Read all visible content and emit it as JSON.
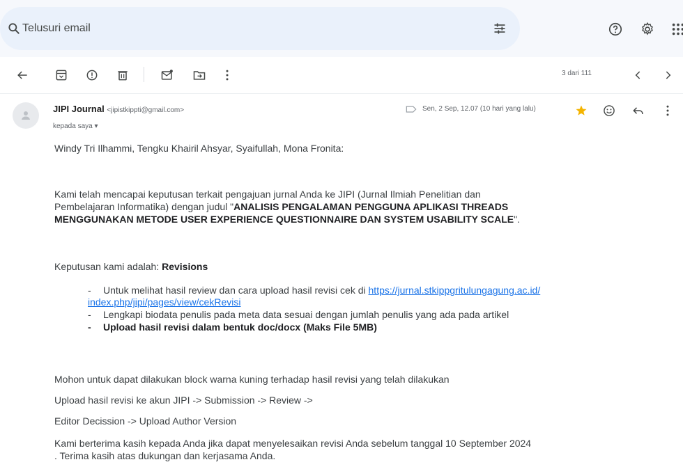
{
  "search": {
    "placeholder": "Telusuri email"
  },
  "toolbar": {
    "pager_text": "3 dari 111"
  },
  "email": {
    "sender_name": "JIPI Journal",
    "sender_email": "<jipistkippti@gmail.com>",
    "recipient": "kepada saya ▾",
    "date": "Sen, 2 Sep, 12.07 (10 hari yang lalu)",
    "greeting": "Windy Tri Ilhammi, Tengku Khairil Ahsyar, Syaifullah, Mona Fronita:",
    "para1_line1": "Kami telah mencapai keputusan terkait pengajuan jurnal Anda ke JIPI (Jurnal Ilmiah Penelitian dan",
    "para1_line2_prefix": "Pembelajaran Informatika) dengan judul \"",
    "title_line1": "ANALISIS PENGALAMAN PENGGUNA APLIKASI THREADS",
    "title_line2": "MENGGUNAKAN METODE USER EXPERIENCE QUESTIONNAIRE DAN SYSTEM USABILITY SCALE",
    "title_suffix": "\".",
    "decision_prefix": "Keputusan kami adalah: ",
    "decision_value": "Revisions",
    "bullet1_text": "Untuk melihat hasil review dan cara upload hasil revisi cek di ",
    "bullet1_link_part1": "https://jurnal.stkippgritulungagung.ac.id/",
    "bullet1_link_part2": "index.php/jipi/pages/view/cekRevisi",
    "bullet2_text": "Lengkapi biodata penulis pada meta data sesuai dengan jumlah penulis yang ada pada artikel",
    "bullet3_text": "Upload hasil revisi dalam bentuk doc/docx (Maks File 5MB)",
    "line_mohon": "Mohon untuk dapat dilakukan block warna kuning terhadap hasil revisi yang telah dilakukan",
    "line_upload": "Upload hasil revisi ke akun JIPI -> Submission -> Review ->",
    "line_editor": "Editor Decission -> Upload Author Version",
    "thanks_line1": "Kami berterima kasih kepada Anda jika dapat menyelesaikan revisi Anda sebelum tanggal 10 September 2024",
    "thanks_line2": ". Terima kasih atas dukungan dan kerjasama Anda."
  },
  "colors": {
    "search_bg": "#eaf1fb",
    "star": "#f4b400",
    "link": "#1a73e8"
  }
}
